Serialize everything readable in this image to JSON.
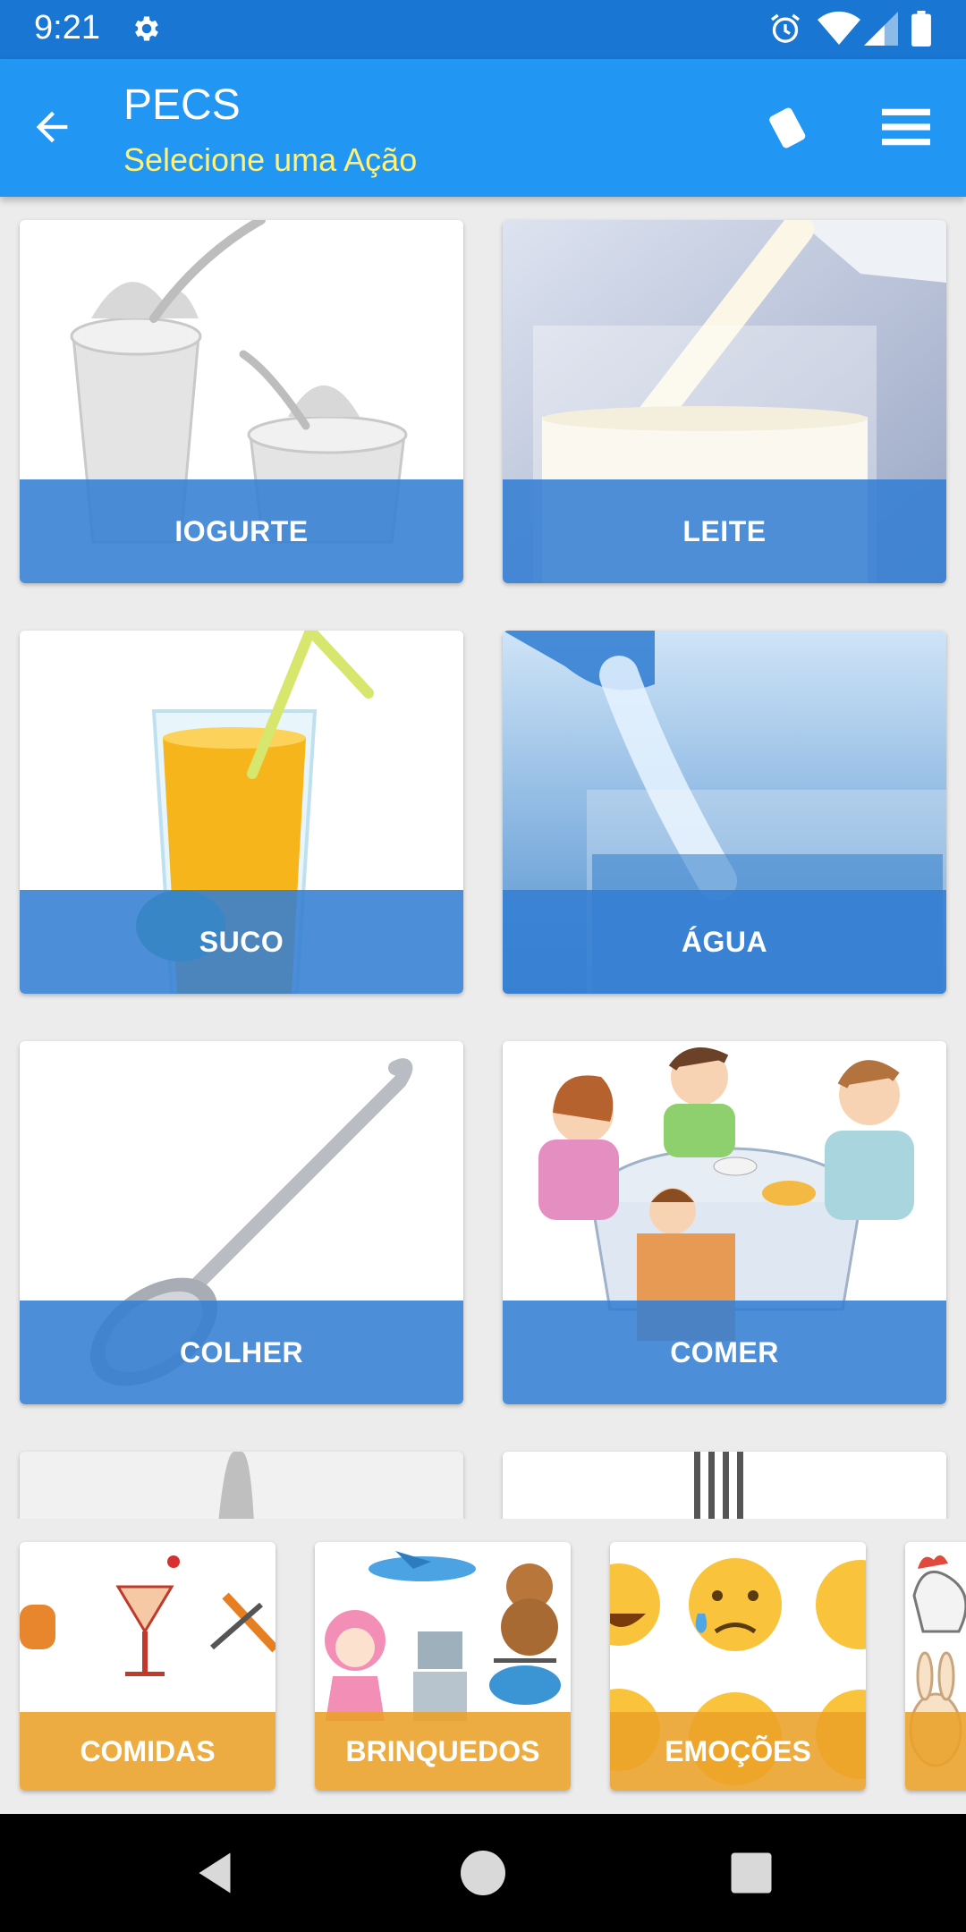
{
  "status": {
    "time": "9:21"
  },
  "appbar": {
    "title": "PECS",
    "subtitle": "Selecione uma Ação"
  },
  "grid": {
    "items": [
      {
        "label": "IOGURTE"
      },
      {
        "label": "LEITE"
      },
      {
        "label": "SUCO"
      },
      {
        "label": "ÁGUA"
      },
      {
        "label": "COLHER"
      },
      {
        "label": "COMER"
      }
    ]
  },
  "categories": [
    {
      "label": "COMIDAS"
    },
    {
      "label": "BRINQUEDOS"
    },
    {
      "label": "EMOÇÕES"
    }
  ],
  "colors": {
    "statusbar": "#1976d2",
    "appbar": "#2196f3",
    "subtitle": "#fff176",
    "card_label": "#347ed3",
    "category_label": "#eba028"
  }
}
